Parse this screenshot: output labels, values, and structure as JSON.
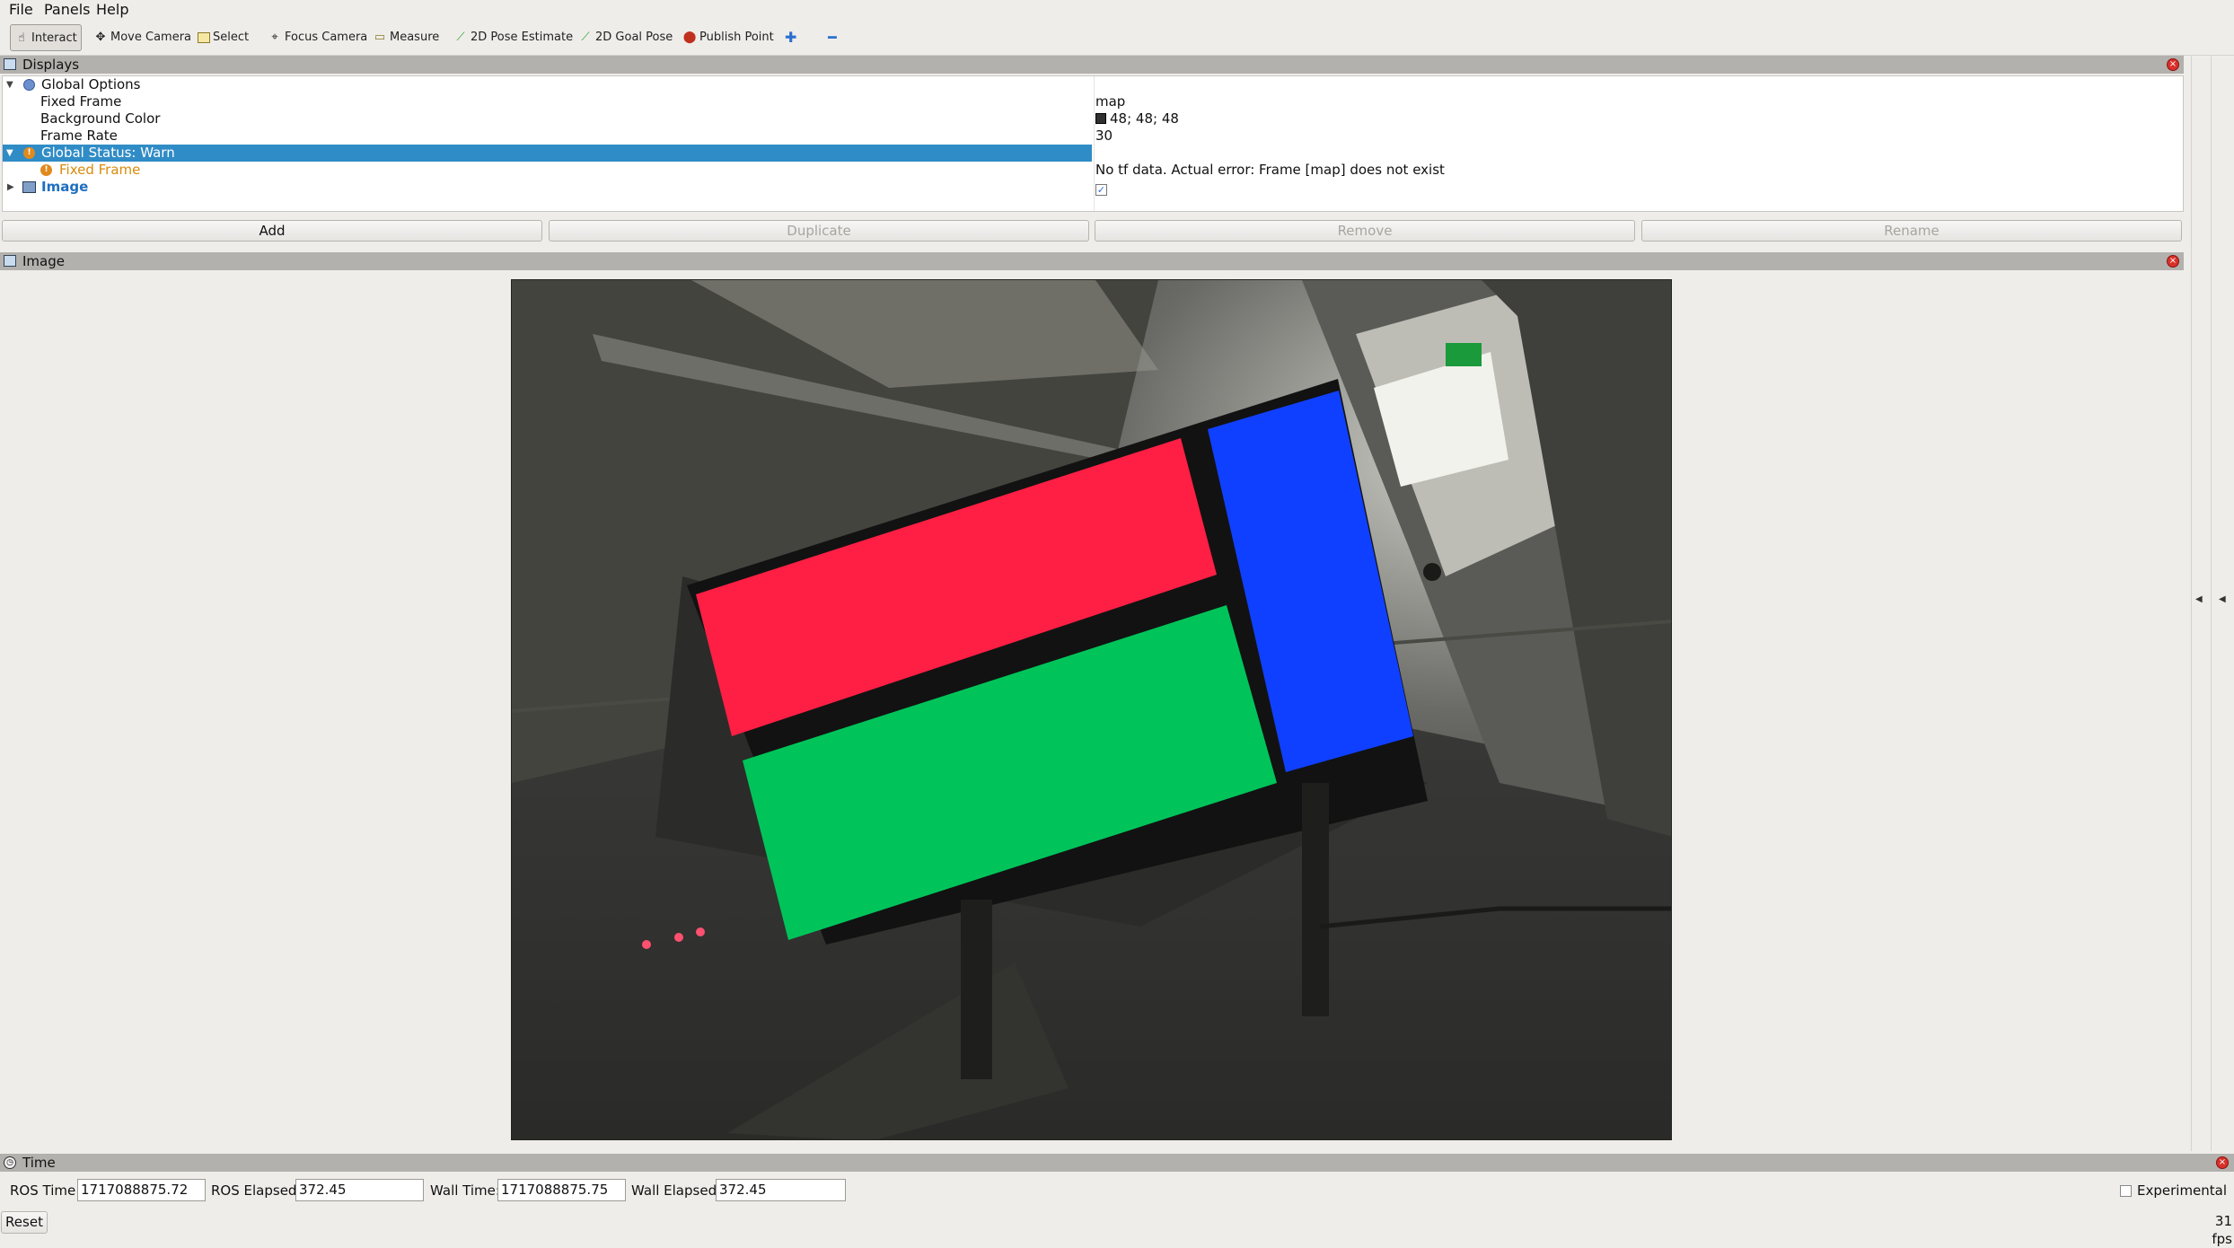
{
  "menu": [
    "File",
    "Panels",
    "Help"
  ],
  "toolbar": {
    "interact": "Interact",
    "move_camera": "Move Camera",
    "select": "Select",
    "focus_camera": "Focus Camera",
    "measure": "Measure",
    "pose_estimate": "2D Pose Estimate",
    "goal_pose": "2D Goal Pose",
    "publish_point": "Publish Point"
  },
  "displays": {
    "title": "Displays",
    "rows": [
      {
        "label": "Global Options",
        "value": ""
      },
      {
        "label": "Fixed Frame",
        "value": "map"
      },
      {
        "label": "Background Color",
        "value": "48; 48; 48"
      },
      {
        "label": "Frame Rate",
        "value": "30"
      },
      {
        "label": "Global Status: Warn",
        "value": ""
      },
      {
        "label": "Fixed Frame",
        "value": "No tf data.  Actual error: Frame [map] does not exist"
      },
      {
        "label": "Image",
        "value": ""
      }
    ],
    "background_color_swatch": "#303030",
    "buttons": {
      "add": "Add",
      "duplicate": "Duplicate",
      "remove": "Remove",
      "rename": "Rename"
    }
  },
  "image_panel": {
    "title": "Image"
  },
  "time_panel": {
    "title": "Time",
    "ros_time_label": "ROS Time:",
    "ros_time": "1717088875.72",
    "ros_elapsed_label": "ROS Elapsed:",
    "ros_elapsed": "372.45",
    "wall_time_label": "Wall Time:",
    "wall_time": "1717088875.75",
    "wall_elapsed_label": "Wall Elapsed:",
    "wall_elapsed": "372.45",
    "experimental_label": "Experimental",
    "reset": "Reset",
    "fps": "31 fps"
  },
  "colors": {
    "selection": "#308cc6",
    "warn": "#e08a1e",
    "error_red": "#ff1f44",
    "green": "#00c45a",
    "blue": "#1040ff"
  }
}
